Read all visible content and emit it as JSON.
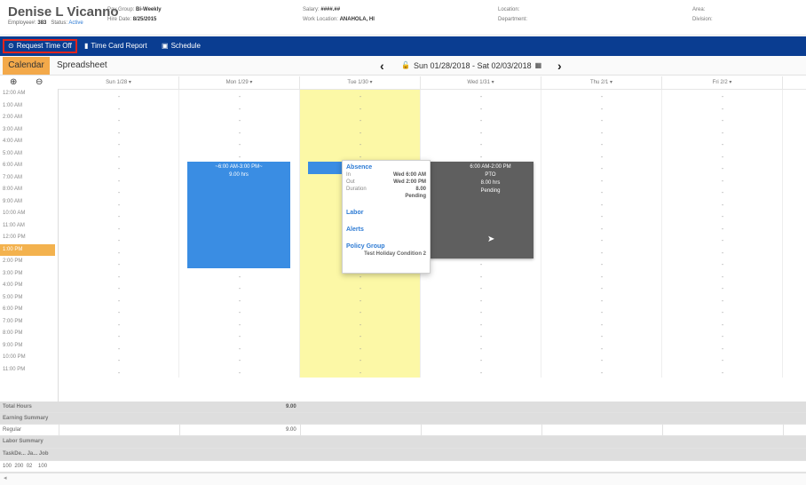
{
  "employee": {
    "name": "Denise L Vicanno",
    "employee_label": "Employee#:",
    "employee_no": "383",
    "status_label": "Status:",
    "status": "Active",
    "pay_group_label": "Pay Group:",
    "pay_group": "Bi-Weekly",
    "hire_date_label": "Hire Date:",
    "hire_date": "8/25/2015",
    "salary_label": "Salary:",
    "salary": "####.##",
    "work_location_label": "Work Location:",
    "work_location": "ANAHOLA, HI",
    "location_label": "Location:",
    "department_label": "Department:",
    "area_label": "Area:",
    "division_label": "Division:"
  },
  "toolbar": {
    "request_time_off": "Request Time Off",
    "time_card_report": "Time Card Report",
    "schedule": "Schedule"
  },
  "tabs": {
    "calendar": "Calendar",
    "spreadsheet": "Spreadsheet"
  },
  "date_nav": {
    "range": "Sun 01/28/2018 - Sat 02/03/2018",
    "prev": "‹",
    "next": "›"
  },
  "zoom": {
    "in": "⊕",
    "out": "⊖"
  },
  "days": [
    "Sun 1/28 ▾",
    "Mon 1/29 ▾",
    "Tue 1/30 ▾",
    "Wed 1/31 ▾",
    "Thu 2/1 ▾",
    "Fri 2/2 ▾"
  ],
  "times": [
    "12:00 AM",
    "1:00 AM",
    "2:00 AM",
    "3:00 AM",
    "4:00 AM",
    "5:00 AM",
    "6:00 AM",
    "7:00 AM",
    "8:00 AM",
    "9:00 AM",
    "10:00 AM",
    "11:00 AM",
    "12:00 PM",
    "1:00 PM",
    "2:00 PM",
    "3:00 PM",
    "4:00 PM",
    "5:00 PM",
    "6:00 PM",
    "7:00 PM",
    "8:00 PM",
    "9:00 PM",
    "10:00 PM",
    "11:00 PM"
  ],
  "events": {
    "monday": {
      "time": "~6:00 AM-3:00 PM~",
      "hours": "9.00 hrs"
    },
    "wednesday": {
      "time": "6:00 AM-2:00 PM",
      "type": "PTO",
      "hours": "8.00 hrs",
      "status": "Pending"
    }
  },
  "tooltip": {
    "absence_title": "Absence",
    "in_label": "In",
    "in_value": "Wed 6:00 AM",
    "out_label": "Out",
    "out_value": "Wed 2:00 PM",
    "duration_label": "Duration",
    "duration_value": "8.00",
    "status_value": "Pending",
    "labor_title": "Labor",
    "alerts_title": "Alerts",
    "policy_title": "Policy Group",
    "policy_value": "Test Holiday Condition 2"
  },
  "summary": {
    "total_hours_label": "Total Hours",
    "total_hours_value": "9.00",
    "earning_summary_label": "Earning Summary",
    "regular_label": "Regular",
    "regular_value": "9.00",
    "labor_summary_label": "Labor Summary",
    "labor_header": "TaskDe... Ja... Job",
    "labor_values": "100  200  02    100"
  },
  "colors": {
    "toolbar_bg": "#0a3d91",
    "calendar_tab": "#f3a94a",
    "today_bg": "#fcf8a6",
    "event_blue": "#3a8de3",
    "event_gray": "#5f5f5f",
    "selected_outline": "#e2241c"
  }
}
